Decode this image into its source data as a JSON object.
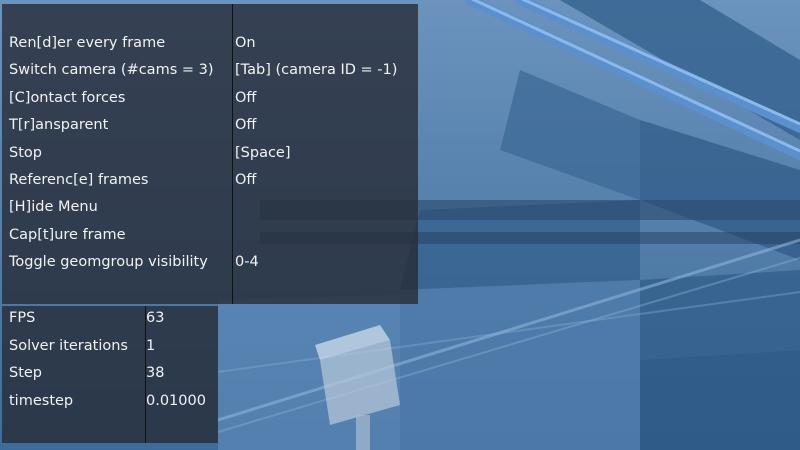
{
  "menu": {
    "items": [
      {
        "label": "Ren[d]er every frame",
        "value": "On"
      },
      {
        "label": "Switch camera (#cams = 3)",
        "value": "[Tab] (camera ID = -1)"
      },
      {
        "label": "[C]ontact forces",
        "value": "Off"
      },
      {
        "label": "T[r]ansparent",
        "value": "Off"
      },
      {
        "label": "Stop",
        "value": "[Space]"
      },
      {
        "label": "Referenc[e] frames",
        "value": "Off"
      },
      {
        "label": "[H]ide Menu",
        "value": ""
      },
      {
        "label": "Cap[t]ure frame",
        "value": ""
      },
      {
        "label": "Toggle geomgroup visibility",
        "value": "0-4"
      }
    ]
  },
  "stats": {
    "items": [
      {
        "label": "FPS",
        "value": "63"
      },
      {
        "label": "Solver iterations",
        "value": "1"
      },
      {
        "label": "Step",
        "value": "38"
      },
      {
        "label": "timestep",
        "value": "0.01000"
      }
    ]
  },
  "scene": {
    "floor_light": "#5a86b4",
    "floor_dark": "#2f5a88",
    "rod_color": "#6f9fd4"
  }
}
